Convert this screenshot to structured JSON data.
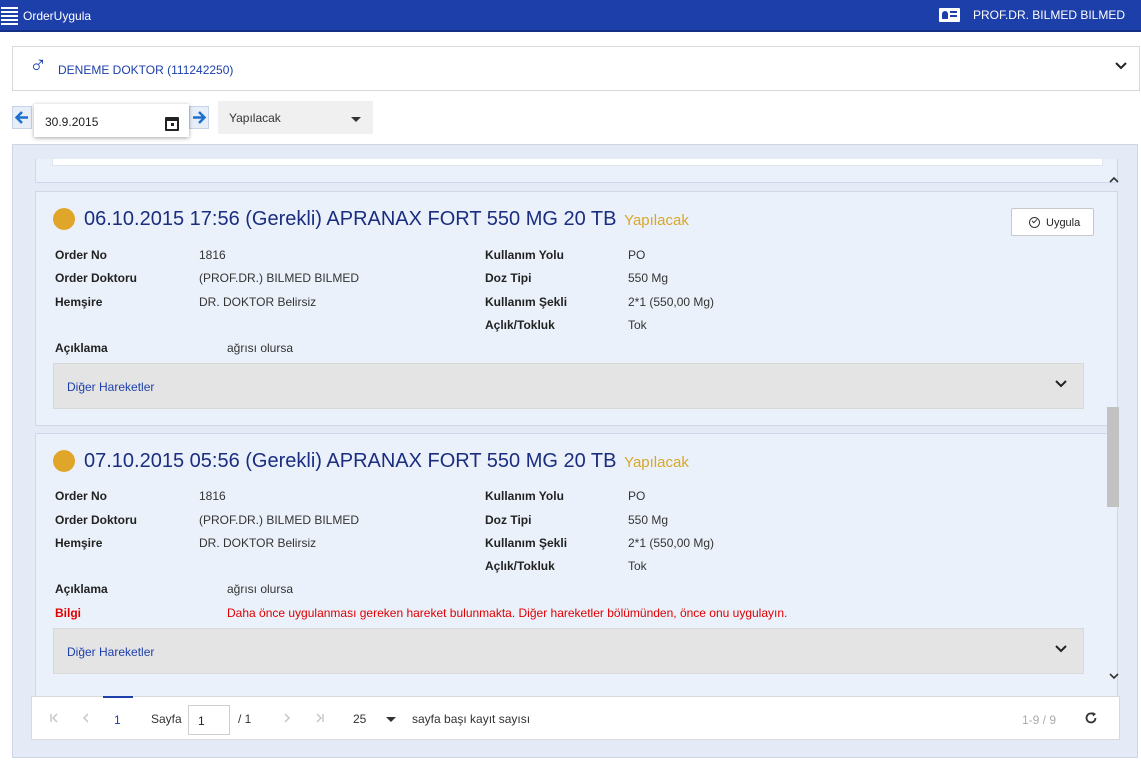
{
  "header": {
    "app_title": "OrderUygula",
    "user_name": "PROF.DR. BILMED BILMED"
  },
  "patient": {
    "name": "DENEME DOKTOR (111242250)"
  },
  "filters": {
    "date": "30.9.2015",
    "status": "Yapılacak"
  },
  "cards": [
    {
      "title": "06.10.2015 17:56 (Gerekli) APRANAX FORT 550 MG 20 TB",
      "state": "Yapılacak",
      "apply_label": "Uygula",
      "order_no_label": "Order No",
      "order_no": "1816",
      "doctor_label": "Order Doktoru",
      "doctor": "(PROF.DR.) BILMED BILMED",
      "nurse_label": "Hemşire",
      "nurse": "DR. DOKTOR Belirsiz",
      "route_label": "Kullanım Yolu",
      "route": "PO",
      "dose_label": "Doz Tipi",
      "dose": "550 Mg",
      "usage_label": "Kullanım Şekli",
      "usage": "2*1 (550,00 Mg)",
      "fasting_label": "Açlık/Tokluk",
      "fasting": "Tok",
      "note_label": "Açıklama",
      "note": "ağrısı olursa",
      "other_label": "Diğer Hareketler"
    },
    {
      "title": "07.10.2015 05:56 (Gerekli) APRANAX FORT 550 MG 20 TB",
      "state": "Yapılacak",
      "order_no_label": "Order No",
      "order_no": "1816",
      "doctor_label": "Order Doktoru",
      "doctor": "(PROF.DR.) BILMED BILMED",
      "nurse_label": "Hemşire",
      "nurse": "DR. DOKTOR Belirsiz",
      "route_label": "Kullanım Yolu",
      "route": "PO",
      "dose_label": "Doz Tipi",
      "dose": "550 Mg",
      "usage_label": "Kullanım Şekli",
      "usage": "2*1 (550,00 Mg)",
      "fasting_label": "Açlık/Tokluk",
      "fasting": "Tok",
      "note_label": "Açıklama",
      "note": "ağrısı olursa",
      "info_label": "Bilgi",
      "info": "Daha önce uygulanması gereken hareket bulunmakta. Diğer hareketler bölümünden, önce onu uygulayın.",
      "other_label": "Diğer Hareketler"
    }
  ],
  "pager": {
    "current_page": "1",
    "page_label": "Sayfa",
    "page_input": "1",
    "page_total": "/ 1",
    "page_size": "25",
    "page_size_label": "sayfa başı kayıt sayısı",
    "range": "1-9 / 9"
  },
  "colors": {
    "brand": "#1d3faa",
    "pending": "#e0a62a",
    "warning": "#e00000"
  }
}
